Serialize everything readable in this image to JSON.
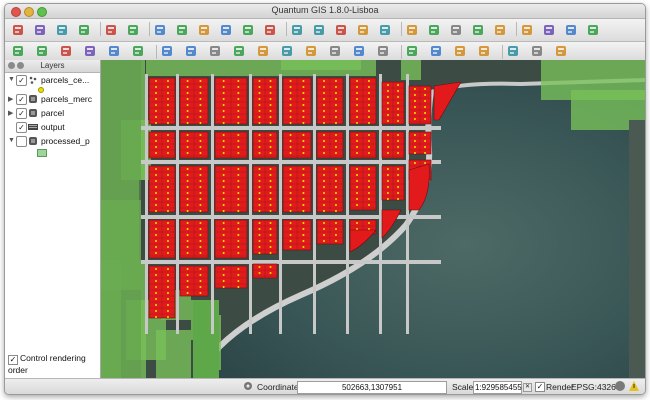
{
  "window": {
    "title": "Quantum GIS 1.8.0-Lisboa"
  },
  "layers_panel": {
    "title": "Layers",
    "items": [
      {
        "label": "parcels_ce...",
        "checked": true,
        "expanded": true,
        "icon": "point-layer-icon"
      },
      {
        "label": "parcels_merc",
        "checked": true,
        "expanded": false,
        "icon": "polygon-layer-icon"
      },
      {
        "label": "parcel",
        "checked": true,
        "expanded": false,
        "icon": "polygon-layer-icon"
      },
      {
        "label": "output",
        "checked": true,
        "expanded": false,
        "icon": "raster-layer-icon"
      },
      {
        "label": "processed_p",
        "checked": false,
        "expanded": true,
        "icon": "polygon-layer-icon"
      }
    ],
    "control_rendering_order": {
      "label": "Control rendering order",
      "checked": true
    }
  },
  "status_bar": {
    "coordinate_label": "Coordinate:",
    "coordinate_value": "502663,1307951",
    "scale_label": "Scale",
    "scale_value": "1:929585455",
    "render_label": "Render",
    "render_checked": true,
    "crs": "EPSG:4326"
  },
  "colors": {
    "parcel_fill": "#e31a1c",
    "parcel_point": "#f2e600",
    "vegetation": "#78c25a",
    "water": "#3f5c5c",
    "road": "#c8c8c8"
  },
  "toolbar_icons": {
    "row1": [
      "new-project-icon",
      "open-project-icon",
      "save-project-icon",
      "save-as-icon",
      "print-composer-icon",
      "new-composer-icon",
      "add-vector-icon",
      "add-raster-icon",
      "add-postgis-icon",
      "add-spatialite-icon",
      "add-wms-icon",
      "add-wfs-icon",
      "new-layer-icon",
      "digitize-icon",
      "edit-icon",
      "add-feature-icon",
      "move-feature-icon",
      "node-tool-icon",
      "delete-icon",
      "cut-icon",
      "copy-icon",
      "paste-icon",
      "undo-icon",
      "redo-icon",
      "plugin-icon",
      "python-icon"
    ],
    "row2": [
      "label-tool-icon",
      "pin-label-icon",
      "highlight-icon",
      "move-label-icon",
      "rotate-label-icon",
      "change-label-icon",
      "pan-icon",
      "pan-to-selection-icon",
      "zoom-in-icon",
      "zoom-out-icon",
      "zoom-full-icon",
      "zoom-layer-icon",
      "zoom-selection-icon",
      "zoom-last-icon",
      "zoom-next-icon",
      "refresh-icon",
      "identify-icon",
      "select-icon",
      "deselect-icon",
      "measure-icon",
      "map-tips-icon",
      "bookmark-icon",
      "help-icon"
    ]
  }
}
